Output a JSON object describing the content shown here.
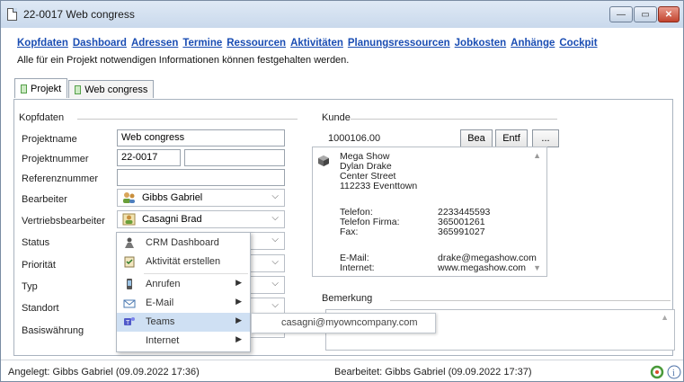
{
  "window": {
    "title": "22-0017 Web congress",
    "min_label": "—",
    "max_label": "▭",
    "close_label": "✕"
  },
  "nav": [
    "Kopfdaten",
    "Dashboard",
    "Adressen",
    "Termine",
    "Ressourcen",
    "Aktivitäten",
    "Planungsressourcen",
    "Jobkosten",
    "Anhänge",
    "Cockpit"
  ],
  "description": "Alle für ein Projekt notwendigen Informationen können festgehalten werden.",
  "tabs": [
    {
      "label": "Projekt",
      "icon": "green-square-icon"
    },
    {
      "label": "Web congress",
      "icon": "green-square-icon"
    }
  ],
  "kopfdaten": {
    "group_title": "Kopfdaten",
    "projektname_label": "Projektname",
    "projektname": "Web congress",
    "projektnummer_label": "Projektnummer",
    "projektnummer": "22-0017",
    "projektnummer_extra": "",
    "referenznummer_label": "Referenznummer",
    "referenznummer": "",
    "bearbeiter_label": "Bearbeiter",
    "bearbeiter": "Gibbs Gabriel",
    "vertriebsbearbeiter_label": "Vertriebsbearbeiter",
    "vertriebsbearbeiter": "Casagni Brad",
    "status_label": "Status",
    "prioritaet_label": "Priorität",
    "typ_label": "Typ",
    "standort_label": "Standort",
    "basiswaehrung_label": "Basiswährung"
  },
  "kunde": {
    "group_title": "Kunde",
    "number": "1000106.00",
    "bea_button": "Bea",
    "entf_button": "Entf",
    "more_button": "...",
    "address": [
      "Mega Show",
      "Dylan Drake",
      "Center Street",
      "112233 Eventtown"
    ],
    "telefon_label": "Telefon:",
    "telefon": "2233445593",
    "telefon_firma_label": "Telefon Firma:",
    "telefon_firma": "365001261",
    "fax_label": "Fax:",
    "fax": "365991027",
    "email_label": "E-Mail:",
    "email": "drake@megashow.com",
    "internet_label": "Internet:",
    "internet": "www.megashow.com"
  },
  "bemerkung": {
    "group_title": "Bemerkung",
    "text": ""
  },
  "context_menu": {
    "items": [
      {
        "label": "CRM Dashboard",
        "icon": "dashboard-icon",
        "submenu": false
      },
      {
        "label": "Aktivität erstellen",
        "icon": "clipboard-icon",
        "submenu": false
      },
      {
        "label": "Anrufen",
        "icon": "phone-icon",
        "submenu": true
      },
      {
        "label": "E-Mail",
        "icon": "mail-icon",
        "submenu": true
      },
      {
        "label": "Teams",
        "icon": "teams-icon",
        "submenu": true
      },
      {
        "label": "Internet",
        "icon": "",
        "submenu": true
      }
    ],
    "highlighted_index": 4,
    "submenu_arrow": "▶",
    "tooltip": "casagni@myowncompany.com"
  },
  "status": {
    "angelegt": "Angelegt: Gibbs Gabriel (09.09.2022 17:36)",
    "bearbeitet": "Bearbeitet: Gibbs Gabriel (09.09.2022 17:37)"
  },
  "colors": {
    "link": "#1a4db3",
    "highlight": "#cfe0f3",
    "close": "#c2442f"
  }
}
